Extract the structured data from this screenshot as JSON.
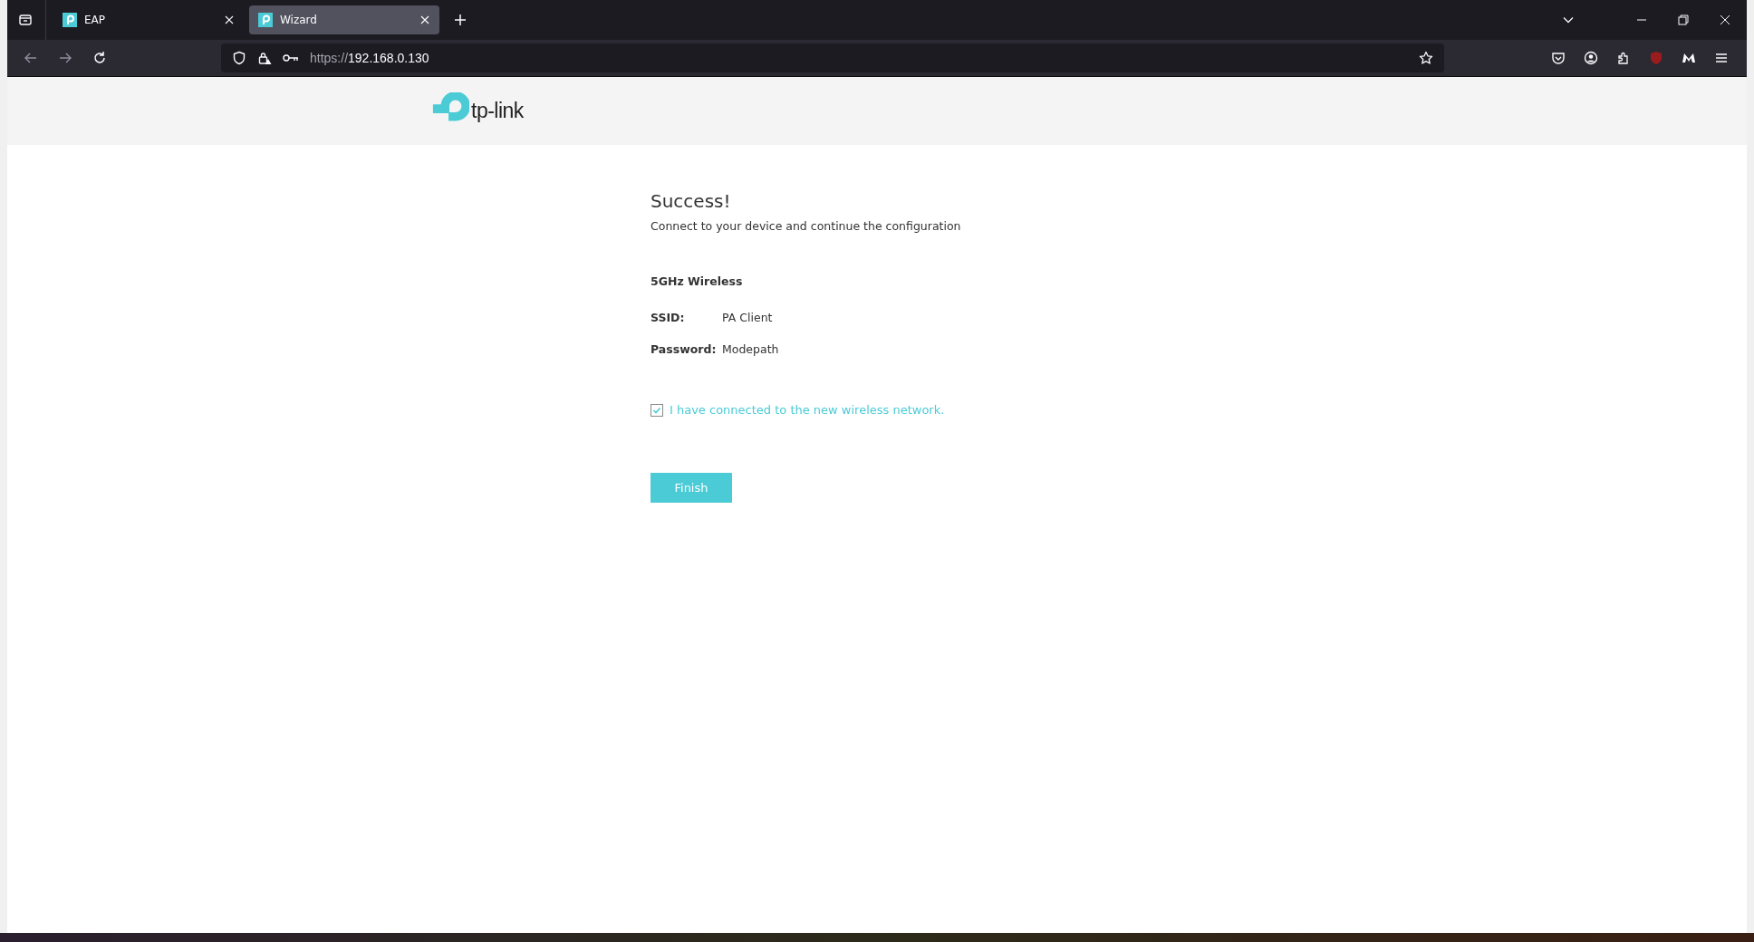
{
  "browser": {
    "tabs": [
      {
        "title": "EAP",
        "selected": false
      },
      {
        "title": "Wizard",
        "selected": true
      }
    ],
    "url": {
      "scheme": "https://",
      "host": "192.168.0.130"
    }
  },
  "header": {
    "logo_text": "tp-link"
  },
  "content": {
    "title": "Success!",
    "subtitle": "Connect to your device and continue the configuration",
    "section": "5GHz Wireless",
    "fields": [
      {
        "label": "SSID:",
        "value": "PA Client"
      },
      {
        "label": "Password:",
        "value": "Modepath"
      }
    ],
    "confirm": {
      "label": "I have connected to the new wireless network.",
      "checked": true
    },
    "button": "Finish"
  }
}
